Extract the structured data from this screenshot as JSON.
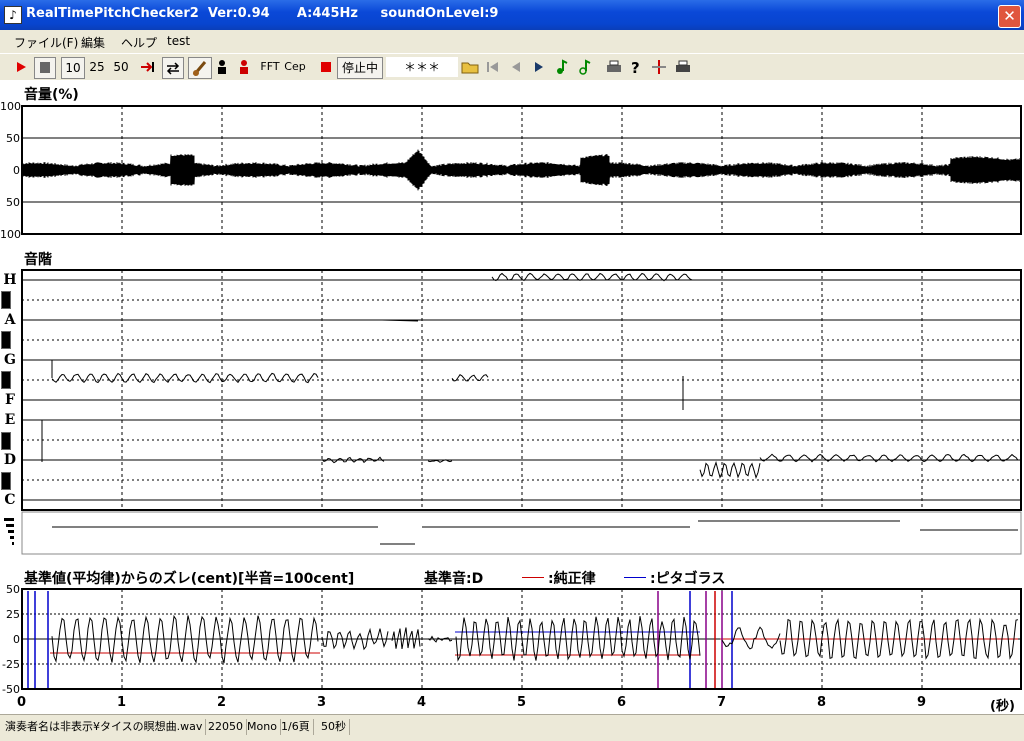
{
  "window": {
    "title": "RealTimePitchChecker2  Ver:0.94      A:445Hz     soundOnLevel:9",
    "close": "✕",
    "icon": "♪"
  },
  "menu": [
    "ファイル(F)",
    "編集",
    "ヘルプ",
    "test"
  ],
  "toolbar": {
    "speeds": [
      "10",
      "25",
      "50"
    ],
    "fft": "FFT",
    "cep": "Cep",
    "status": "停止中",
    "stars": "＊＊＊"
  },
  "volume": {
    "title": "音量(%)",
    "ylabels": [
      "100",
      "50",
      "0",
      "50",
      "100"
    ]
  },
  "scale": {
    "title": "音階",
    "notes": [
      "H",
      "A",
      "G",
      "F",
      "E",
      "D",
      "C"
    ]
  },
  "deviation": {
    "title": "基準値(平均律)からのズレ(cent)[半音=100cent]",
    "base": "基準音:D",
    "legend": [
      {
        "label": ":純正律",
        "color": "#cc0000"
      },
      {
        "label": ":ピタゴラス",
        "color": "#0000cc"
      }
    ],
    "ylabels": [
      "50",
      "25",
      "0",
      "-25",
      "-50"
    ]
  },
  "time_axis": {
    "labels": [
      "0",
      "1",
      "2",
      "3",
      "4",
      "5",
      "6",
      "7",
      "8",
      "9"
    ],
    "unit": "(秒)"
  },
  "status": [
    "演奏者名は非表示¥タイスの瞑想曲.wav",
    "22050",
    "Mono",
    "1/6頁",
    "50秒"
  ]
}
